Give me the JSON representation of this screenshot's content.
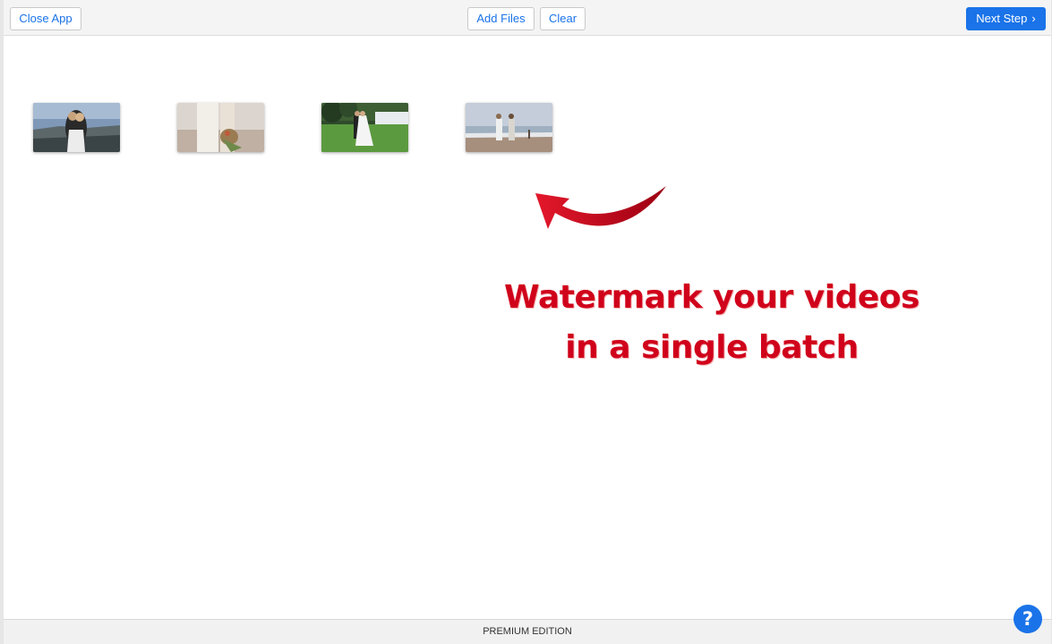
{
  "toolbar": {
    "close_label": "Close App",
    "add_files_label": "Add Files",
    "clear_label": "Clear",
    "next_step_label": "Next Step",
    "next_step_icon": "chevron-right-icon"
  },
  "files": [
    {
      "thumbnail": "couple-seaside-embrace",
      "colors": {
        "sky": "#8fa6c4",
        "ground": "#3f4a4e"
      }
    },
    {
      "thumbnail": "bride-bouquet-closeup",
      "colors": {
        "sky": "#d8d0c8",
        "ground": "#b9a89a"
      }
    },
    {
      "thumbnail": "couple-dancing-lawn",
      "colors": {
        "sky": "#2d4a2a",
        "ground": "#4e8a35"
      }
    },
    {
      "thumbnail": "couple-beach-walk",
      "colors": {
        "sky": "#c3ccd8",
        "ground": "#a58e7c"
      }
    }
  ],
  "promo": {
    "line1": "Watermark your videos",
    "line2": "in a single batch",
    "color": "#d0021b"
  },
  "footer": {
    "edition_label": "PREMIUM EDITION"
  },
  "help": {
    "icon": "question-mark-icon",
    "glyph": "?"
  },
  "colors": {
    "accent": "#1a73e8",
    "promo_red": "#d0021b"
  }
}
